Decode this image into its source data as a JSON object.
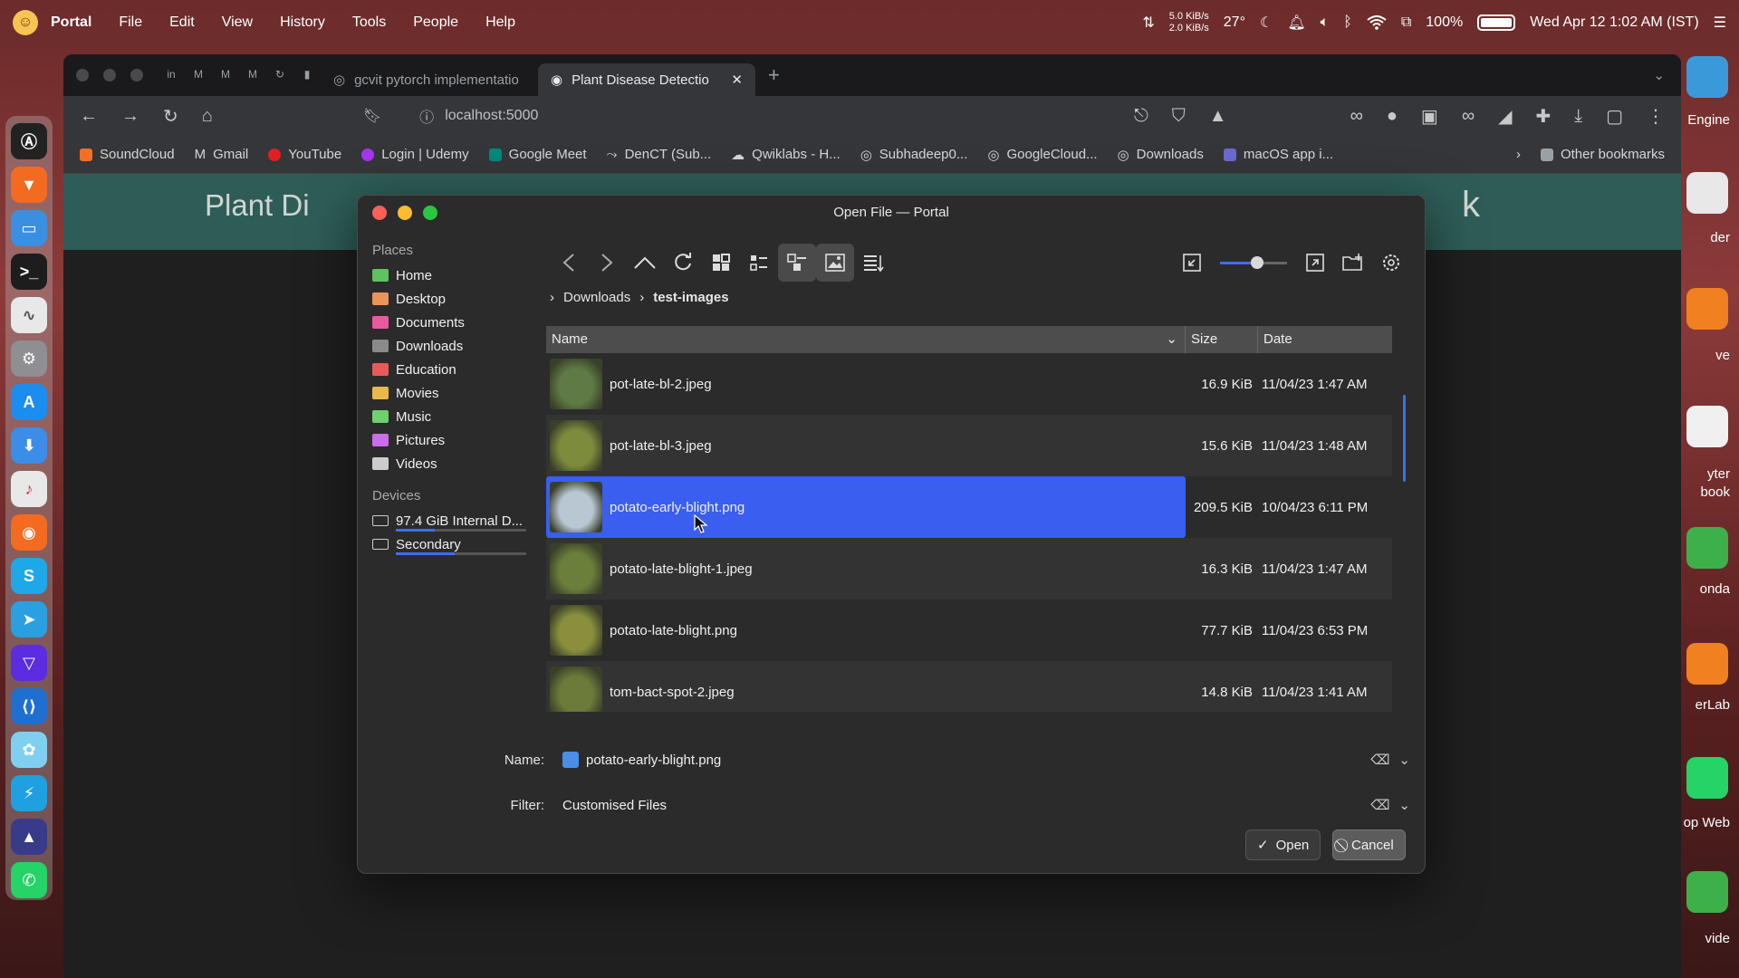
{
  "menubar": {
    "app_name": "Portal",
    "menus": [
      "File",
      "Edit",
      "View",
      "History",
      "Tools",
      "People",
      "Help"
    ],
    "net_up": "5.0 KiB/s",
    "net_down": "2.0 KiB/s",
    "temperature": "27°",
    "battery": "100%",
    "battery_level": 1.0,
    "datetime": "Wed Apr 12  1:02 AM (IST)"
  },
  "desktop_labels": [
    "Engine",
    "der",
    "ve",
    "yter\nbook",
    "onda",
    "erLab",
    "op Web",
    "vide"
  ],
  "browser": {
    "tabs": [
      {
        "title": "gcvit pytorch implementatio",
        "active": false
      },
      {
        "title": "Plant Disease Detectio",
        "active": true
      }
    ],
    "url": "localhost:5000",
    "bookmarks": [
      "SoundCloud",
      "Gmail",
      "YouTube",
      "Login | Udemy",
      "Google Meet",
      "DenCT (Sub...",
      "Qwiklabs - H...",
      "Subhadeep0...",
      "GoogleCloud...",
      "Downloads",
      "macOS app i..."
    ],
    "other_bookmarks": "Other bookmarks",
    "page_header_left": "Plant Di",
    "page_header_right": "k"
  },
  "dialog": {
    "title": "Open File — Portal",
    "places_title": "Places",
    "places": [
      {
        "label": "Home",
        "color": "#5ec25e"
      },
      {
        "label": "Desktop",
        "color": "#e8945a"
      },
      {
        "label": "Documents",
        "color": "#e85aa0"
      },
      {
        "label": "Downloads",
        "color": "#8a8a8a"
      },
      {
        "label": "Education",
        "color": "#e85a5a"
      },
      {
        "label": "Movies",
        "color": "#e8b94a"
      },
      {
        "label": "Music",
        "color": "#6ed06e"
      },
      {
        "label": "Pictures",
        "color": "#c86ee8"
      },
      {
        "label": "Videos",
        "color": "#cccccc"
      }
    ],
    "devices_title": "Devices",
    "devices": [
      {
        "label": "97.4 GiB Internal D...",
        "usage": 0.3
      },
      {
        "label": "Secondary",
        "usage": 0.45
      }
    ],
    "breadcrumb": [
      "Downloads",
      "test-images"
    ],
    "columns": {
      "name": "Name",
      "size": "Size",
      "date": "Date"
    },
    "files": [
      {
        "name": "pot-late-bl-2.jpeg",
        "size": "16.9 KiB",
        "date": "11/04/23 1:47 AM",
        "selected": false,
        "thumb": "#5f7a44"
      },
      {
        "name": "pot-late-bl-3.jpeg",
        "size": "15.6 KiB",
        "date": "11/04/23 1:48 AM",
        "selected": false,
        "thumb": "#7d8b3c"
      },
      {
        "name": "potato-early-blight.png",
        "size": "209.5 KiB",
        "date": "10/04/23 6:11 PM",
        "selected": true,
        "thumb": "#b9c7d3"
      },
      {
        "name": "potato-late-blight-1.jpeg",
        "size": "16.3 KiB",
        "date": "11/04/23 1:47 AM",
        "selected": false,
        "thumb": "#6a7f3a"
      },
      {
        "name": "potato-late-blight.png",
        "size": "77.7 KiB",
        "date": "11/04/23 6:53 PM",
        "selected": false,
        "thumb": "#8a8f3c"
      },
      {
        "name": "tom-bact-spot-2.jpeg",
        "size": "14.8 KiB",
        "date": "11/04/23 1:41 AM",
        "selected": false,
        "thumb": "#6c7a3a"
      }
    ],
    "name_label": "Name:",
    "name_value": "potato-early-blight.png",
    "filter_label": "Filter:",
    "filter_value": "Customised Files",
    "open_button": "Open",
    "cancel_button": "Cancel",
    "zoom_level": 0.55
  },
  "colors": {
    "accent": "#3a5ef0",
    "page_header": "#2e5d57"
  }
}
